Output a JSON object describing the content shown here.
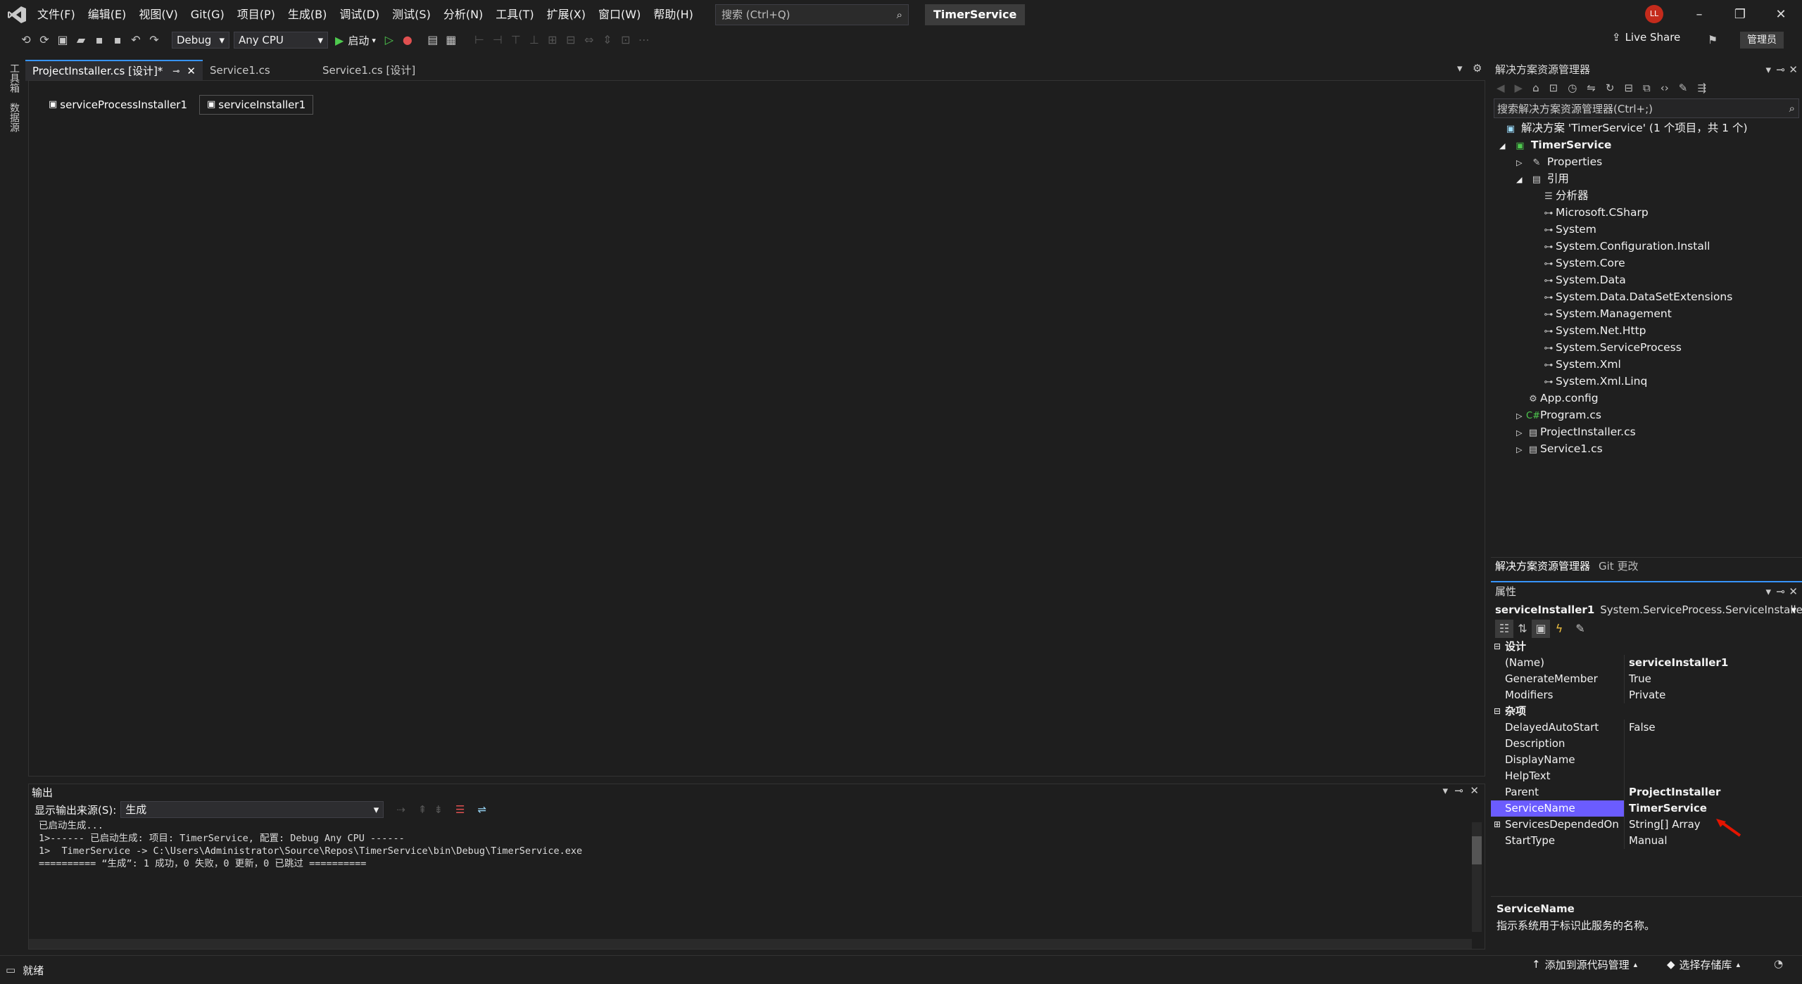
{
  "titlebar": {
    "menu": [
      "文件(F)",
      "编辑(E)",
      "视图(V)",
      "Git(G)",
      "项目(P)",
      "生成(B)",
      "调试(D)",
      "测试(S)",
      "分析(N)",
      "工具(T)",
      "扩展(X)",
      "窗口(W)",
      "帮助(H)"
    ],
    "search_placeholder": "搜索 (Ctrl+Q)",
    "app_title": "TimerService",
    "avatar": "LL"
  },
  "toolbar": {
    "config": "Debug",
    "platform": "Any CPU",
    "start_label": "启动",
    "live_share": "Live Share",
    "admin": "管理员"
  },
  "leftstrip": {
    "toolbox": "工具箱",
    "datasource": "数据源"
  },
  "tabs": [
    {
      "label": "ProjectInstaller.cs [设计]*",
      "active": true
    },
    {
      "label": "Service1.cs",
      "active": false
    },
    {
      "label": "Service1.cs [设计]",
      "active": false
    }
  ],
  "designer": {
    "components": [
      "serviceProcessInstaller1",
      "serviceInstaller1"
    ]
  },
  "output": {
    "title": "输出",
    "source_label": "显示输出来源(S):",
    "source_value": "生成",
    "lines": [
      "已启动生成...",
      "1>------ 已启动生成: 项目: TimerService, 配置: Debug Any CPU ------",
      "1>  TimerService -> C:\\Users\\Administrator\\Source\\Repos\\TimerService\\bin\\Debug\\TimerService.exe",
      "========== “生成”: 1 成功，0 失败，0 更新，0 已跳过 =========="
    ]
  },
  "solution": {
    "title": "解决方案资源管理器",
    "search_placeholder": "搜索解决方案资源管理器(Ctrl+;)",
    "root": "解决方案 'TimerService' (1 个项目，共 1 个)",
    "project": "TimerService",
    "properties": "Properties",
    "references_label": "引用",
    "references": [
      "分析器",
      "Microsoft.CSharp",
      "System",
      "System.Configuration.Install",
      "System.Core",
      "System.Data",
      "System.Data.DataSetExtensions",
      "System.Management",
      "System.Net.Http",
      "System.ServiceProcess",
      "System.Xml",
      "System.Xml.Linq"
    ],
    "files": [
      "App.config",
      "Program.cs",
      "ProjectInstaller.cs",
      "Service1.cs"
    ],
    "bottom_tabs": [
      "解决方案资源管理器",
      "Git 更改"
    ]
  },
  "properties": {
    "title": "属性",
    "object_name": "serviceInstaller1",
    "object_type": "System.ServiceProcess.ServiceInstalle",
    "categories": [
      {
        "name": "设计",
        "rows": [
          {
            "name": "(Name)",
            "value": "serviceInstaller1",
            "bold": true
          },
          {
            "name": "GenerateMember",
            "value": "True"
          },
          {
            "name": "Modifiers",
            "value": "Private"
          }
        ]
      },
      {
        "name": "杂项",
        "rows": [
          {
            "name": "DelayedAutoStart",
            "value": "False"
          },
          {
            "name": "Description",
            "value": ""
          },
          {
            "name": "DisplayName",
            "value": ""
          },
          {
            "name": "HelpText",
            "value": ""
          },
          {
            "name": "Parent",
            "value": "ProjectInstaller",
            "bold": true
          },
          {
            "name": "ServiceName",
            "value": "TimerService",
            "bold": true,
            "selected": true
          },
          {
            "name": "ServicesDependedOn",
            "value": "String[] Array",
            "expandable": true
          },
          {
            "name": "StartType",
            "value": "Manual"
          }
        ]
      }
    ],
    "desc_title": "ServiceName",
    "desc_text": "指示系统用于标识此服务的名称。"
  },
  "status": {
    "ready": "就绪",
    "source_control": "添加到源代码管理",
    "repo": "选择存储库"
  },
  "colors": {
    "accent": "#3794ff",
    "selected": "#6b5cff",
    "arrow": "#e51400"
  }
}
